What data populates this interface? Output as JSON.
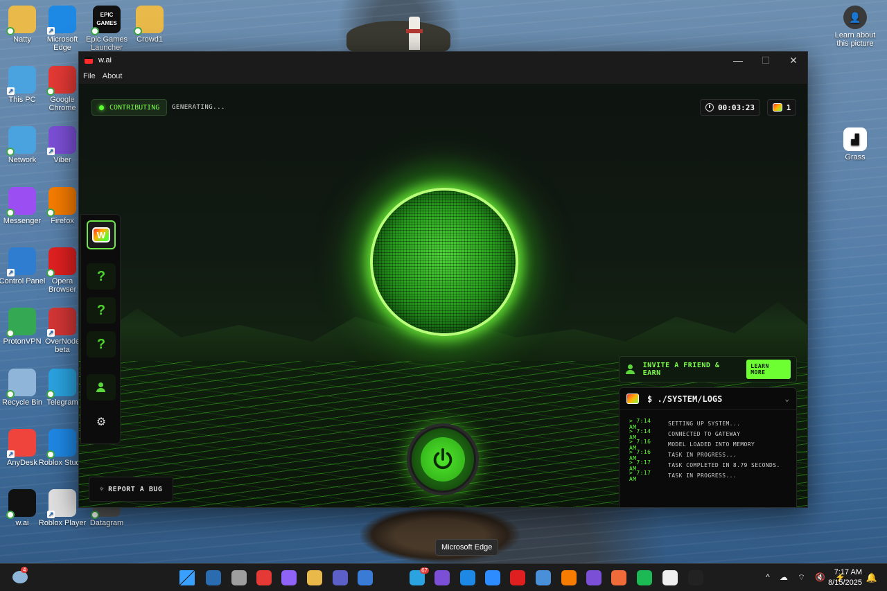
{
  "desktop": {
    "icons_left": [
      {
        "label": "Natty",
        "color": "#e9b949"
      },
      {
        "label": "Microsoft Edge",
        "color": "#1e88e5"
      },
      {
        "label": "Epic Games Launcher",
        "color": "#111111"
      },
      {
        "label": "Crowd1",
        "color": "#e9b949"
      },
      {
        "label": "This PC",
        "color": "#4aa3df"
      },
      {
        "label": "Google Chrome",
        "color": "#e53935"
      },
      {
        "label": "Network",
        "color": "#4aa3df"
      },
      {
        "label": "Viber",
        "color": "#7b4fd6"
      },
      {
        "label": "Messenger",
        "color": "#9b4ef2"
      },
      {
        "label": "Firefox",
        "color": "#f57c00"
      },
      {
        "label": "Control Panel",
        "color": "#2e7dd1"
      },
      {
        "label": "Opera Browser",
        "color": "#e02020"
      },
      {
        "label": "ProtonVPN",
        "color": "#35a853"
      },
      {
        "label": "OverNode beta",
        "color": "#d43535"
      },
      {
        "label": "Recycle Bin",
        "color": "#8fb6d8"
      },
      {
        "label": "Telegram",
        "color": "#2aa3e0"
      },
      {
        "label": "AnyDesk",
        "color": "#ef443b"
      },
      {
        "label": "Roblox Studio",
        "color": "#1e88e5"
      },
      {
        "label": "w.ai",
        "color": "#111111"
      },
      {
        "label": "Roblox Player",
        "color": "#e0e0e0"
      },
      {
        "label": "Datagram",
        "color": "#555555"
      }
    ],
    "icons_right": [
      {
        "label": "Learn about this picture"
      },
      {
        "label": "Grass"
      }
    ],
    "epic_text": "EPIC GAMES"
  },
  "window": {
    "title": "w.ai",
    "menu": [
      "File",
      "About"
    ],
    "controls": {
      "minimize": "—",
      "maximize": "☐",
      "close": "✕"
    }
  },
  "app": {
    "status": "CONTRIBUTING",
    "status_detail": "GENERATING...",
    "timer": "00:03:23",
    "count": "1",
    "sidebar": {
      "logo": "W",
      "locked": [
        "?",
        "?",
        "?"
      ],
      "gear": "⚙"
    },
    "report_bug": "REPORT A BUG",
    "invite": {
      "label": "INVITE A FRIEND & EARN",
      "button": "LEARN MORE"
    },
    "logs": {
      "title": "$ ./SYSTEM/LOGS",
      "entries": [
        {
          "time": "> 7:14 AM",
          "msg": "SETTING UP SYSTEM..."
        },
        {
          "time": "> 7:14 AM",
          "msg": "CONNECTED TO GATEWAY"
        },
        {
          "time": "> 7:16 AM",
          "msg": "MODEL LOADED INTO MEMORY"
        },
        {
          "time": "> 7:16 AM",
          "msg": "TASK IN PROGRESS..."
        },
        {
          "time": "> 7:17 AM",
          "msg": "TASK COMPLETED IN 8.79 SECONDS."
        },
        {
          "time": "> 7:17 AM",
          "msg": "TASK IN PROGRESS..."
        }
      ]
    }
  },
  "tooltip": "Microsoft Edge",
  "taskbar": {
    "apps": [
      {
        "name": "start-button",
        "color": "#3aa0ff"
      },
      {
        "name": "search-button",
        "color": "#2b6cb0"
      },
      {
        "name": "task-view-button",
        "color": "#9e9e9e"
      },
      {
        "name": "chrome-taskbar",
        "color": "#e53935"
      },
      {
        "name": "copilot-taskbar",
        "color": "#8e63f5"
      },
      {
        "name": "explorer-taskbar",
        "color": "#e9b949"
      },
      {
        "name": "teams-taskbar",
        "color": "#5b5fc7"
      },
      {
        "name": "widgets-taskbar",
        "color": "#3a7bd5"
      },
      {
        "name": "telegram-taskbar",
        "color": "#2aa3e0"
      },
      {
        "name": "viber-taskbar",
        "color": "#7b4fd6"
      },
      {
        "name": "edge-taskbar",
        "color": "#1e88e5"
      },
      {
        "name": "zoom-taskbar",
        "color": "#2d8cff"
      },
      {
        "name": "opera-taskbar",
        "color": "#e02020"
      },
      {
        "name": "notepad-taskbar",
        "color": "#4a90d9"
      },
      {
        "name": "firefox-taskbar",
        "color": "#f57c00"
      },
      {
        "name": "app-purple-taskbar",
        "color": "#7b4fd6"
      },
      {
        "name": "app-orange-taskbar",
        "color": "#ef6c3a"
      },
      {
        "name": "spotify-taskbar",
        "color": "#1db954"
      },
      {
        "name": "grass-taskbar",
        "color": "#eeeeee"
      },
      {
        "name": "wai-taskbar",
        "color": "#222222"
      }
    ],
    "telegram_badge": "67",
    "tray": [
      "^",
      "☁",
      "⌔",
      "🔇",
      "⚡"
    ],
    "time": "7:17 AM",
    "date": "8/15/2025",
    "notif_badge": "4"
  }
}
